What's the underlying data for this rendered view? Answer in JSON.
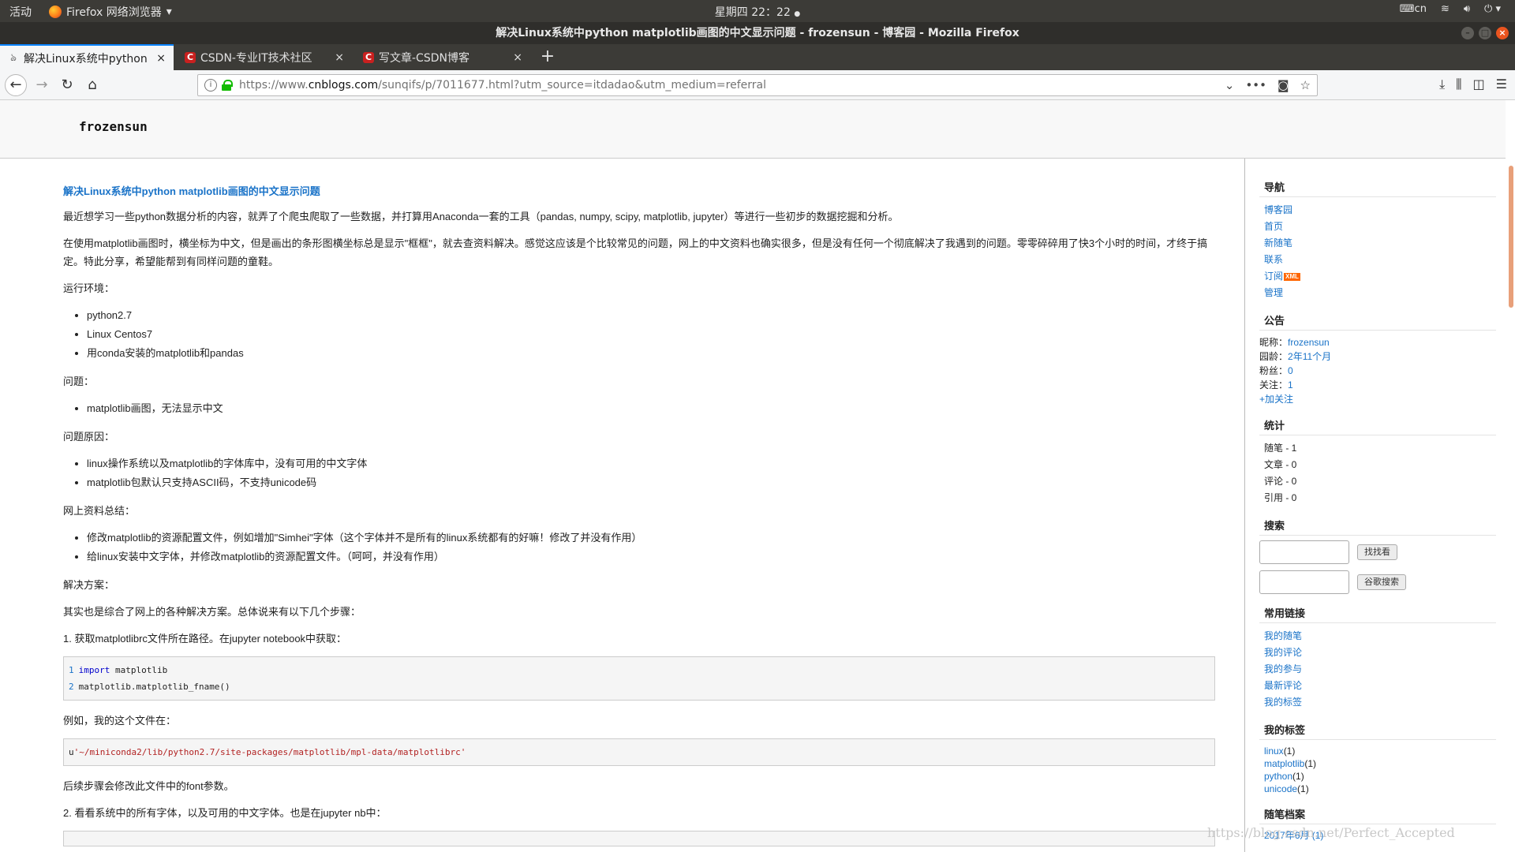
{
  "system_bar": {
    "activities": "活动",
    "app_name": "Firefox 网络浏览器",
    "clock": "星期四 22：22",
    "keyboard": "cn"
  },
  "window": {
    "title": "解决Linux系统中python matplotlib画图的中文显示问题 - frozensun - 博客园 - Mozilla Firefox"
  },
  "tabs": [
    {
      "label": "解决Linux系统中python",
      "close": "×",
      "icon": "cnblogs-favicon"
    },
    {
      "label": "CSDN-专业IT技术社区",
      "close": "×",
      "icon": "csdn-favicon"
    },
    {
      "label": "写文章-CSDN博客",
      "close": "×",
      "icon": "csdn-favicon"
    }
  ],
  "new_tab_label": "+",
  "address": {
    "prefix": "https://www.",
    "domain": "cnblogs.com",
    "path": "/sunqifs/p/7011677.html?utm_source=itdadao&utm_medium=referral"
  },
  "blog": {
    "name": "frozensun"
  },
  "article": {
    "title": "解决Linux系统中python matplotlib画图的中文显示问题",
    "p1": "最近想学习一些python数据分析的内容，就弄了个爬虫爬取了一些数据，并打算用Anaconda一套的工具（pandas, numpy, scipy, matplotlib, jupyter）等进行一些初步的数据挖掘和分析。",
    "p2": "在使用matplotlib画图时，横坐标为中文，但是画出的条形图横坐标总是显示\"框框\"，就去查资料解决。感觉这应该是个比较常见的问题，网上的中文资料也确实很多，但是没有任何一个彻底解决了我遇到的问题。零零碎碎用了快3个小时的时间，才终于搞定。特此分享，希望能帮到有同样问题的童鞋。",
    "env_label": "运行环境：",
    "env_items": [
      "python2.7",
      "Linux Centos7",
      "用conda安装的matplotlib和pandas"
    ],
    "problem_label": "问题：",
    "problem_items": [
      "matplotlib画图，无法显示中文"
    ],
    "cause_label": "问题原因：",
    "cause_items": [
      "linux操作系统以及matplotlib的字体库中，没有可用的中文字体",
      "matplotlib包默认只支持ASCII码，不支持unicode码"
    ],
    "summary_label": "网上资料总结：",
    "summary_items": [
      "修改matplotlib的资源配置文件，例如增加\"Simhei\"字体（这个字体并不是所有的linux系统都有的好嘛！修改了并没有作用）",
      "给linux安装中文字体，并修改matplotlib的资源配置文件。（呵呵，并没有作用）"
    ],
    "solution_label": "解决方案：",
    "solution_intro": "其实也是综合了网上的各种解决方案。总体说来有以下几个步骤：",
    "step1": "1. 获取matplotlibrc文件所在路径。在jupyter notebook中获取：",
    "code1": [
      {
        "num": "1",
        "kw": "import",
        "rest": " matplotlib"
      },
      {
        "num": "2",
        "kw": "",
        "rest": "matplotlib.matplotlib_fname()"
      }
    ],
    "example_label": "例如，我的这个文件在：",
    "code2_prefix": "u",
    "code2_string": "'~/miniconda2/lib/python2.7/site-packages/matplotlib/mpl-data/matplotlibrc'",
    "after_code": "后续步骤会修改此文件中的font参数。",
    "step2": "2. 看看系统中的所有字体，以及可用的中文字体。也是在jupyter nb中："
  },
  "sidebar": {
    "nav_title": "导航",
    "nav_items": [
      "博客园",
      "首页",
      "新随笔",
      "联系",
      "订阅",
      "管理"
    ],
    "xml_badge": "XML",
    "notice_title": "公告",
    "notice": [
      {
        "label": "昵称：",
        "value": "frozensun"
      },
      {
        "label": "园龄：",
        "value": "2年11个月"
      },
      {
        "label": "粉丝：",
        "value": "0"
      },
      {
        "label": "关注：",
        "value": "1"
      }
    ],
    "follow": "+加关注",
    "stats_title": "统计",
    "stats": [
      "随笔 - 1",
      "文章 - 0",
      "评论 - 0",
      "引用 - 0"
    ],
    "search_title": "搜索",
    "search_btn1": "找找看",
    "search_btn2": "谷歌搜索",
    "links_title": "常用链接",
    "links": [
      "我的随笔",
      "我的评论",
      "我的参与",
      "最新评论",
      "我的标签"
    ],
    "tags_title": "我的标签",
    "tags": [
      {
        "name": "linux",
        "count": "(1)"
      },
      {
        "name": "matplotlib",
        "count": "(1)"
      },
      {
        "name": "python",
        "count": "(1)"
      },
      {
        "name": "unicode",
        "count": "(1)"
      }
    ],
    "archive_title": "随笔档案",
    "archive": [
      "2017年6月 (1)"
    ]
  },
  "watermark": "https://blog.csdn.net/Perfect_Accepted",
  "colors": {
    "panel": "#3c3b37",
    "link": "#1a73c8",
    "accent": "#0a84ff",
    "close_button": "#e9541f"
  }
}
